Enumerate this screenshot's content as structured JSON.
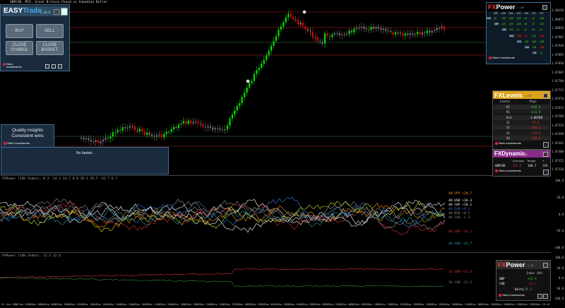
{
  "chart": {
    "title": "GBPCAD, M15:  Great Britain Pound vs Canadian Dollar",
    "price_ticks": [
      "1.88120",
      "1.88075",
      "1.88030",
      "1.87985",
      "1.87940",
      "1.87895",
      "1.87850",
      "1.87805",
      "1.87760",
      "1.87715",
      "1.87670",
      "1.87625",
      "1.87580",
      "1.87535",
      "1.87490",
      "1.87445",
      "1.87400",
      "1.87355",
      "1.87310"
    ],
    "right_label": "FxPower",
    "time_ticks": [
      "24 Sep 2025",
      "24 Sep 07:45",
      "24 Sep 08:45",
      "24 Sep 09:45",
      "24 Sep 10:45",
      "24 Sep 11:45",
      "24 Sep 12:45",
      "24 Sep 13:45",
      "24 Sep 14:45",
      "24 Sep 15:45",
      "24 Sep 16:45",
      "24 Sep 17:45",
      "24 Sep 18:45",
      "24 Sep 19:45",
      "24 Sep 20:45",
      "24 Sep 21:45",
      "24 Sep 22:45",
      "24 Sep 23:45",
      "25 Sep 00:45",
      "25 Sep 01:45",
      "25 Sep 02:45",
      "25 Sep 03:45",
      "25 Sep 04:45",
      "25 Sep 05:45",
      "25 Sep 06:45",
      "25 Sep 07:45",
      "25 Sep 08:45",
      "25 Sep 09:45",
      "25 Sep 10:45",
      "25 Sep 11:45",
      "25 Sep 12:45",
      "25 Sep 13:45",
      "25 Sep 14:45",
      "25 Sep 15:45",
      "25 Sep 16:45",
      "25 Sep 17:45",
      "25 Sep 18:45",
      "25 Sep 19:45",
      "25 Sep 20:45",
      "25 Sep 21:45",
      "25 Sep 22:45",
      "25 Sep 23:45"
    ]
  },
  "easytrade": {
    "logo_a": "EASY",
    "logo_b": "Trade",
    "version": "1.26.6",
    "buy": "BUY",
    "sell": "SELL",
    "close_symbol": "CLOSE\nSYMBOL",
    "close_basket": "CLOSE\nBASKET",
    "brand_line1": "Stein",
    "brand_line2": "Investments"
  },
  "quality_box": {
    "line1": "Quality insights",
    "line2": "Consistent wins",
    "brand": "Stein Investments"
  },
  "basket_box": {
    "text": "No basket."
  },
  "fxpower": {
    "title_a": "FX",
    "title_b": "Power",
    "version": "v.20",
    "currencies": [
      "GBP",
      "AUD",
      "NZD",
      "USD",
      "CAD",
      "CHF",
      "JPY"
    ],
    "rows": [
      {
        "ccy": "EUR",
        "vals": [
          "+9",
          "+32",
          "+45",
          "+33",
          "+9",
          "+2",
          "+26"
        ]
      },
      {
        "ccy": "GBP",
        "vals": [
          "+23",
          "+47",
          "+25",
          "+0",
          "+7",
          "+23"
        ]
      },
      {
        "ccy": "AUD",
        "vals": [
          "+14",
          "+4",
          "+7",
          "+0",
          "+4"
        ]
      },
      {
        "ccy": "NZD",
        "vals": [
          "-19",
          "-6",
          "+11",
          "-11"
        ]
      },
      {
        "ccy": "USD",
        "vals": [
          "+19",
          "+22",
          "+20"
        ]
      },
      {
        "ccy": "CAD",
        "vals": [
          "+10",
          "-23"
        ]
      },
      {
        "ccy": "CHF",
        "vals": [
          "+1"
        ]
      }
    ],
    "brand": "Stein Investments"
  },
  "fxlevels": {
    "title_a": "FX",
    "title_b": "Levels",
    "version": "v.38",
    "col1": "Levels",
    "col2": "Pips",
    "rows": [
      {
        "name": "R2",
        "val": "+142.2",
        "color": "#4ad04a"
      },
      {
        "name": "R1",
        "val": "+115.8",
        "color": "#4ad04a"
      },
      {
        "name": "Bid",
        "val": "1.86768",
        "color": "#ffffff"
      },
      {
        "name": "S1",
        "val": "-53.6",
        "color": "#e03030"
      },
      {
        "name": "S2",
        "val": "-104.0",
        "color": "#e03030"
      },
      {
        "name": "S3",
        "val": "-129.4",
        "color": "#e03030"
      },
      {
        "name": "S4",
        "val": "-150.4",
        "color": "#e03030"
      }
    ],
    "brand": "Stein Investments"
  },
  "dynamic": {
    "title_a": "FX",
    "title_b": "Dynamic",
    "version": "v.46",
    "headers": [
      "Average",
      "Range",
      "%"
    ],
    "symbol": "GBPCAD",
    "avg": "115.9",
    "range": "140.7",
    "pct": "119",
    "brand": "Stein Investments"
  },
  "indicator1": {
    "title": "FXPower (24H Index): 8.3  -14.2  24.7  0.0  16.1  29.7  -42.7  6.7",
    "labels": [
      {
        "text": "4H JPY +28.7",
        "color": "#ff9900"
      },
      {
        "text": "4H USD +16.3",
        "color": "#ffffff"
      },
      {
        "text": "4H CHF +16.1",
        "color": "#ffffff"
      },
      {
        "text": "4H EUR +9.3",
        "color": "#3d7ee0"
      },
      {
        "text": "4H NZD +0.7",
        "color": "#999999"
      },
      {
        "text": "4H CAD -1.3",
        "color": "#888888"
      },
      {
        "text": "4H GBP -14.7",
        "color": "#e03030"
      },
      {
        "text": "4H AUD -42.7",
        "color": "#27a0b0"
      }
    ],
    "ticks": [
      "100.0",
      "50.0",
      "0.0",
      "-50.0",
      "-100.0"
    ]
  },
  "indicator2": {
    "title": "FXPower (24H Index): 12.5  12.6",
    "labels": [
      {
        "text": "1H GBP +12.9",
        "color": "#e03030"
      },
      {
        "text": "1H CAD -12.5",
        "color": "#888888"
      }
    ],
    "ticks": [
      "100.0",
      "50.0",
      "0.0",
      "-50.0",
      "-100.0"
    ]
  },
  "fxpower_small": {
    "title_a": "FX",
    "title_b": "Power",
    "version": "v.20",
    "header": "Index (H4)",
    "rows": [
      {
        "ccy": "GBP",
        "val": "+12.9"
      },
      {
        "ccy": "CAD",
        "val": "-12.5"
      }
    ],
    "delta_label": "Delta",
    "delta": "25.2",
    "brand": "Stein Investments"
  },
  "colors": {
    "up": "#00e000",
    "down": "#e00000",
    "neutral": "#777777",
    "panel": "#1a2b3e",
    "accent": "#3d6e94"
  }
}
